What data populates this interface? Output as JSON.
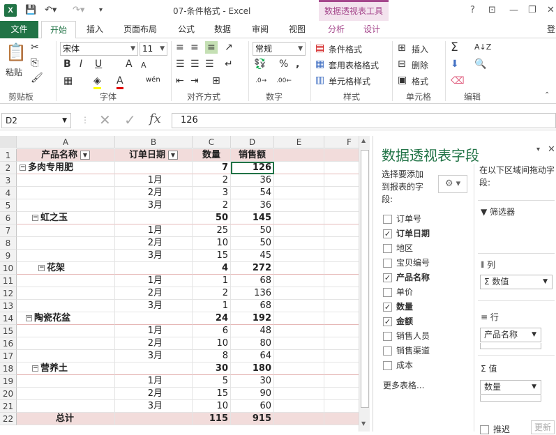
{
  "app": {
    "title": "07-条件格式 - Excel",
    "logo": "X",
    "context_tab_group": "数据透视表工具",
    "sign_in": "登"
  },
  "tabs": [
    "文件",
    "开始",
    "插入",
    "页面布局",
    "公式",
    "数据",
    "审阅",
    "视图",
    "分析",
    "设计"
  ],
  "ribbon": {
    "clipboard": {
      "paste_label": "粘贴",
      "group_label": "剪贴板"
    },
    "font": {
      "font_name": "宋体",
      "font_size": "11",
      "bold": "B",
      "italic": "I",
      "underline": "U",
      "grow": "A",
      "shrink": "A",
      "wen": "wén",
      "group_label": "字体"
    },
    "alignment": {
      "group_label": "对齐方式"
    },
    "number": {
      "format": "常规",
      "percent": "%",
      "comma": ",",
      "group_label": "数字"
    },
    "styles": {
      "conditional": "条件格式",
      "as_table": "套用表格格式",
      "cell_styles": "单元格样式",
      "group_label": "样式"
    },
    "cells": {
      "insert": "插入",
      "delete": "删除",
      "format": "格式",
      "group_label": "单元格"
    },
    "editing": {
      "group_label": "编辑"
    }
  },
  "formula_bar": {
    "name_box": "D2",
    "value": "126",
    "fx": "fx"
  },
  "sheet": {
    "columns": [
      "A",
      "B",
      "C",
      "D",
      "E",
      "F"
    ],
    "header": {
      "a": "产品名称",
      "b": "订单日期",
      "c": "数量",
      "d": "销售额"
    },
    "rows": [
      {
        "n": "2",
        "a": "多肉专用肥",
        "b": "",
        "c": "7",
        "d": "126",
        "type": "grp",
        "indent": 0
      },
      {
        "n": "3",
        "a": "",
        "b": "1月",
        "c": "2",
        "d": "36",
        "type": "sub"
      },
      {
        "n": "4",
        "a": "",
        "b": "2月",
        "c": "3",
        "d": "54",
        "type": "sub"
      },
      {
        "n": "5",
        "a": "",
        "b": "3月",
        "c": "2",
        "d": "36",
        "type": "sub"
      },
      {
        "n": "6",
        "a": "虹之玉",
        "b": "",
        "c": "50",
        "d": "145",
        "type": "grp",
        "indent": 2
      },
      {
        "n": "7",
        "a": "",
        "b": "1月",
        "c": "25",
        "d": "50",
        "type": "sub"
      },
      {
        "n": "8",
        "a": "",
        "b": "2月",
        "c": "10",
        "d": "50",
        "type": "sub"
      },
      {
        "n": "9",
        "a": "",
        "b": "3月",
        "c": "15",
        "d": "45",
        "type": "sub"
      },
      {
        "n": "10",
        "a": "花架",
        "b": "",
        "c": "4",
        "d": "272",
        "type": "grp",
        "indent": 3
      },
      {
        "n": "11",
        "a": "",
        "b": "1月",
        "c": "1",
        "d": "68",
        "type": "sub"
      },
      {
        "n": "12",
        "a": "",
        "b": "2月",
        "c": "2",
        "d": "136",
        "type": "sub"
      },
      {
        "n": "13",
        "a": "",
        "b": "3月",
        "c": "1",
        "d": "68",
        "type": "sub"
      },
      {
        "n": "14",
        "a": "陶瓷花盆",
        "b": "",
        "c": "24",
        "d": "192",
        "type": "grp",
        "indent": 1
      },
      {
        "n": "15",
        "a": "",
        "b": "1月",
        "c": "6",
        "d": "48",
        "type": "sub"
      },
      {
        "n": "16",
        "a": "",
        "b": "2月",
        "c": "10",
        "d": "80",
        "type": "sub"
      },
      {
        "n": "17",
        "a": "",
        "b": "3月",
        "c": "8",
        "d": "64",
        "type": "sub"
      },
      {
        "n": "18",
        "a": "营养土",
        "b": "",
        "c": "30",
        "d": "180",
        "type": "grp",
        "indent": 2
      },
      {
        "n": "19",
        "a": "",
        "b": "1月",
        "c": "5",
        "d": "30",
        "type": "sub"
      },
      {
        "n": "20",
        "a": "",
        "b": "2月",
        "c": "15",
        "d": "90",
        "type": "sub"
      },
      {
        "n": "21",
        "a": "",
        "b": "3月",
        "c": "10",
        "d": "60",
        "type": "sub"
      }
    ],
    "total": {
      "n": "22",
      "a": "总计",
      "c": "115",
      "d": "915"
    },
    "header_row_num": "1"
  },
  "pivot_pane": {
    "title": "数据透视表字段",
    "choose_fields": "选择要添加到报表的字段:",
    "drag_hint": "在以下区域间拖动字段:",
    "fields": [
      {
        "name": "订单号",
        "checked": false
      },
      {
        "name": "订单日期",
        "checked": true
      },
      {
        "name": "地区",
        "checked": false
      },
      {
        "name": "宝贝编号",
        "checked": false
      },
      {
        "name": "产品名称",
        "checked": true
      },
      {
        "name": "单价",
        "checked": false
      },
      {
        "name": "数量",
        "checked": true
      },
      {
        "name": "金额",
        "checked": true
      },
      {
        "name": "销售人员",
        "checked": false
      },
      {
        "name": "销售渠道",
        "checked": false
      },
      {
        "name": "成本",
        "checked": false
      }
    ],
    "more_tables": "更多表格...",
    "areas": {
      "filters": "筛选器",
      "columns": "列",
      "columns_item": "数值",
      "rows": "行",
      "rows_item": "产品名称",
      "values": "值",
      "values_item": "数量"
    },
    "defer": "推迟",
    "update": "更新"
  }
}
